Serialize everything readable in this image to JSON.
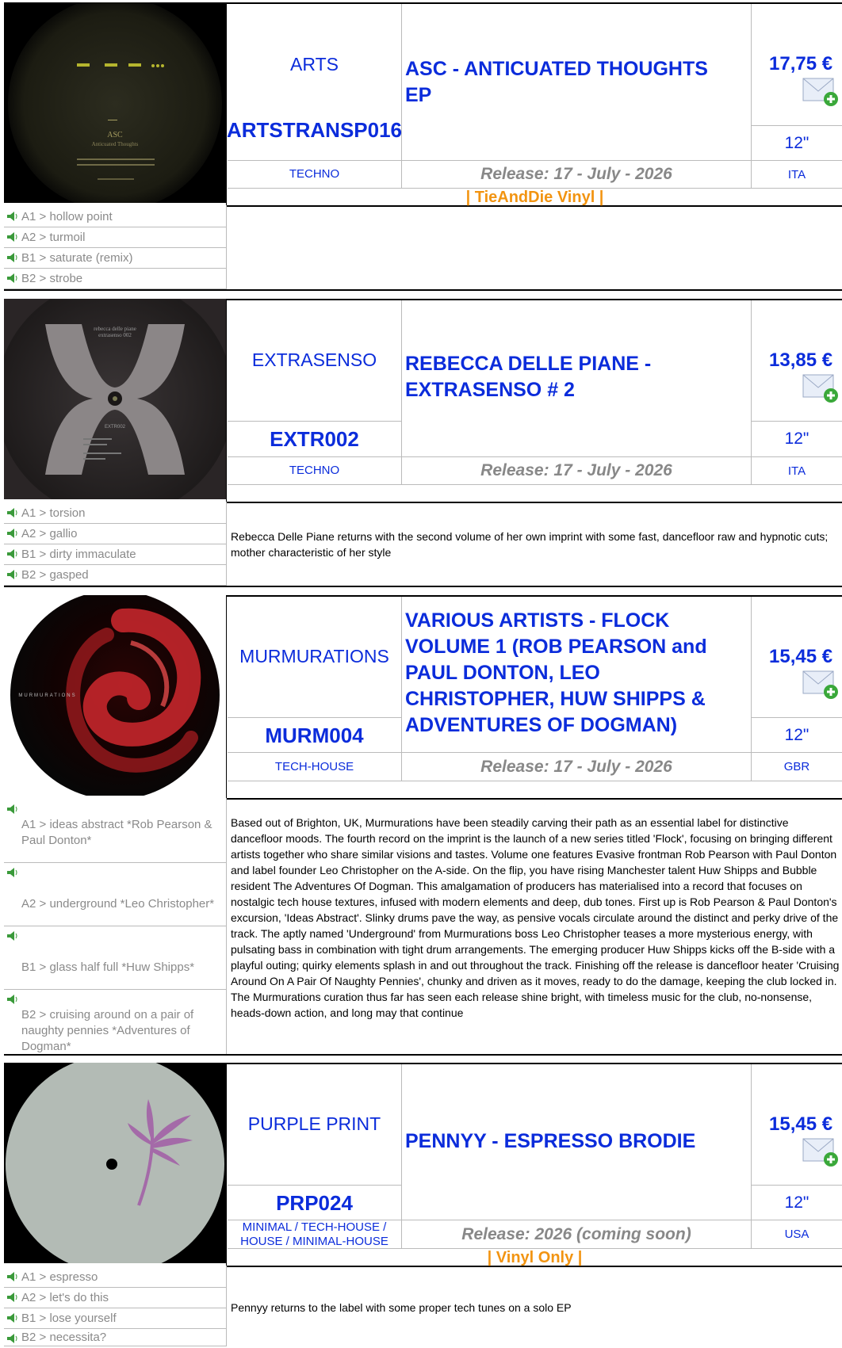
{
  "releases": [
    {
      "label": "ARTS",
      "catalog": "ARTSTRANSP016",
      "title": "ASC - ANTICUATED THOUGHTS EP",
      "price": "17,75 €",
      "format": "12\"",
      "genre": "TECHNO",
      "release": "Release: 17 - July - 2026",
      "country": "ITA",
      "tag": "| TieAndDie Vinyl |",
      "description": "",
      "tracks": [
        "A1 > hollow point",
        "A2 > turmoil",
        "B1 > saturate (remix)",
        "B2 > strobe"
      ],
      "cover_lettering": [
        "ASC",
        "Anticuated Thoughts"
      ]
    },
    {
      "label": "EXTRASENSO",
      "catalog": "EXTR002",
      "title": "REBECCA DELLE PIANE - EXTRASENSO # 2",
      "price": "13,85 €",
      "format": "12\"",
      "genre": "TECHNO",
      "release": "Release: 17 - July - 2026",
      "country": "ITA",
      "tag": "",
      "description": "Rebecca Delle Piane returns with the second volume of her own imprint with some fast, dancefloor raw and hypnotic cuts; mother characteristic of her style",
      "tracks": [
        "A1 > torsion",
        "A2 > gallio",
        "B1 > dirty immaculate",
        "B2 > gasped"
      ],
      "cover_lettering": [
        "rebecca delle piane",
        "extrasenso 002",
        "EXTR002"
      ]
    },
    {
      "label": "MURMURATIONS",
      "catalog": "MURM004",
      "title": "VARIOUS ARTISTS - FLOCK VOLUME 1 (ROB PEARSON and PAUL DONTON, LEO CHRISTOPHER, HUW SHIPPS & ADVENTURES OF DOGMAN)",
      "price": "15,45 €",
      "format": "12\"",
      "genre": "TECH-HOUSE",
      "release": "Release: 17 - July - 2026",
      "country": "GBR",
      "tag": "",
      "description": "Based out of Brighton, UK, Murmurations have been steadily carving their path as an essential label for distinctive dancefloor moods. The fourth record on the imprint is the launch of a new series titled 'Flock', focusing on bringing different artists together who share similar visions and tastes. Volume one features Evasive frontman Rob Pearson with Paul Donton and label founder Leo Christopher on the A-side. On the flip, you have rising Manchester talent Huw Shipps and Bubble resident The Adventures Of Dogman. This amalgamation of producers has materialised into a record that focuses on nostalgic tech house textures, infused with modern elements and deep, dub tones. First up is Rob Pearson & Paul Donton's excursion, 'Ideas Abstract'. Slinky drums pave the way, as pensive vocals circulate around the distinct and perky drive of the track. The aptly named 'Underground' from Murmurations boss Leo Christopher teases a more mysterious energy, with pulsating bass in combination with tight drum arrangements. The emerging producer Huw Shipps kicks off the B-side with a playful outing; quirky elements splash in and out throughout the track. Finishing off the release is dancefloor heater 'Cruising Around On A Pair Of Naughty Pennies', chunky and driven as it moves, ready to do the damage, keeping the club locked in. The Murmurations curation thus far has seen each release shine bright, with timeless music for the club, no-nonsense, heads-down action, and long may that continue",
      "tracks": [
        "A1 > ideas abstract *Rob Pearson & Paul Donton*",
        "A2 > underground *Leo Christopher*",
        "B1 > glass half full *Huw Shipps*",
        "B2 > cruising around on a pair of naughty pennies *Adventures of Dogman*"
      ],
      "cover_lettering": [
        "MURMURATIONS"
      ]
    },
    {
      "label": "PURPLE PRINT",
      "catalog": "PRP024",
      "title": "PENNYY - ESPRESSO BRODIE",
      "price": "15,45 €",
      "format": "12\"",
      "genre": "MINIMAL / TECH-HOUSE / HOUSE / MINIMAL-HOUSE",
      "release": "Release: 2026 (coming soon)",
      "country": "USA",
      "tag": "| Vinyl Only |",
      "description": "Pennyy returns to the label with some proper tech tunes on a solo EP",
      "tracks": [
        "A1 > espresso",
        "A2 > let's do this",
        "B1 > lose yourself",
        "B2 > necessita?"
      ],
      "cover_lettering": []
    }
  ],
  "icons": {
    "speaker": "speaker-icon",
    "cart": "email-add-icon"
  },
  "colors": {
    "link": "#0b2cdb",
    "muted": "#888888",
    "tag": "#f29411"
  }
}
